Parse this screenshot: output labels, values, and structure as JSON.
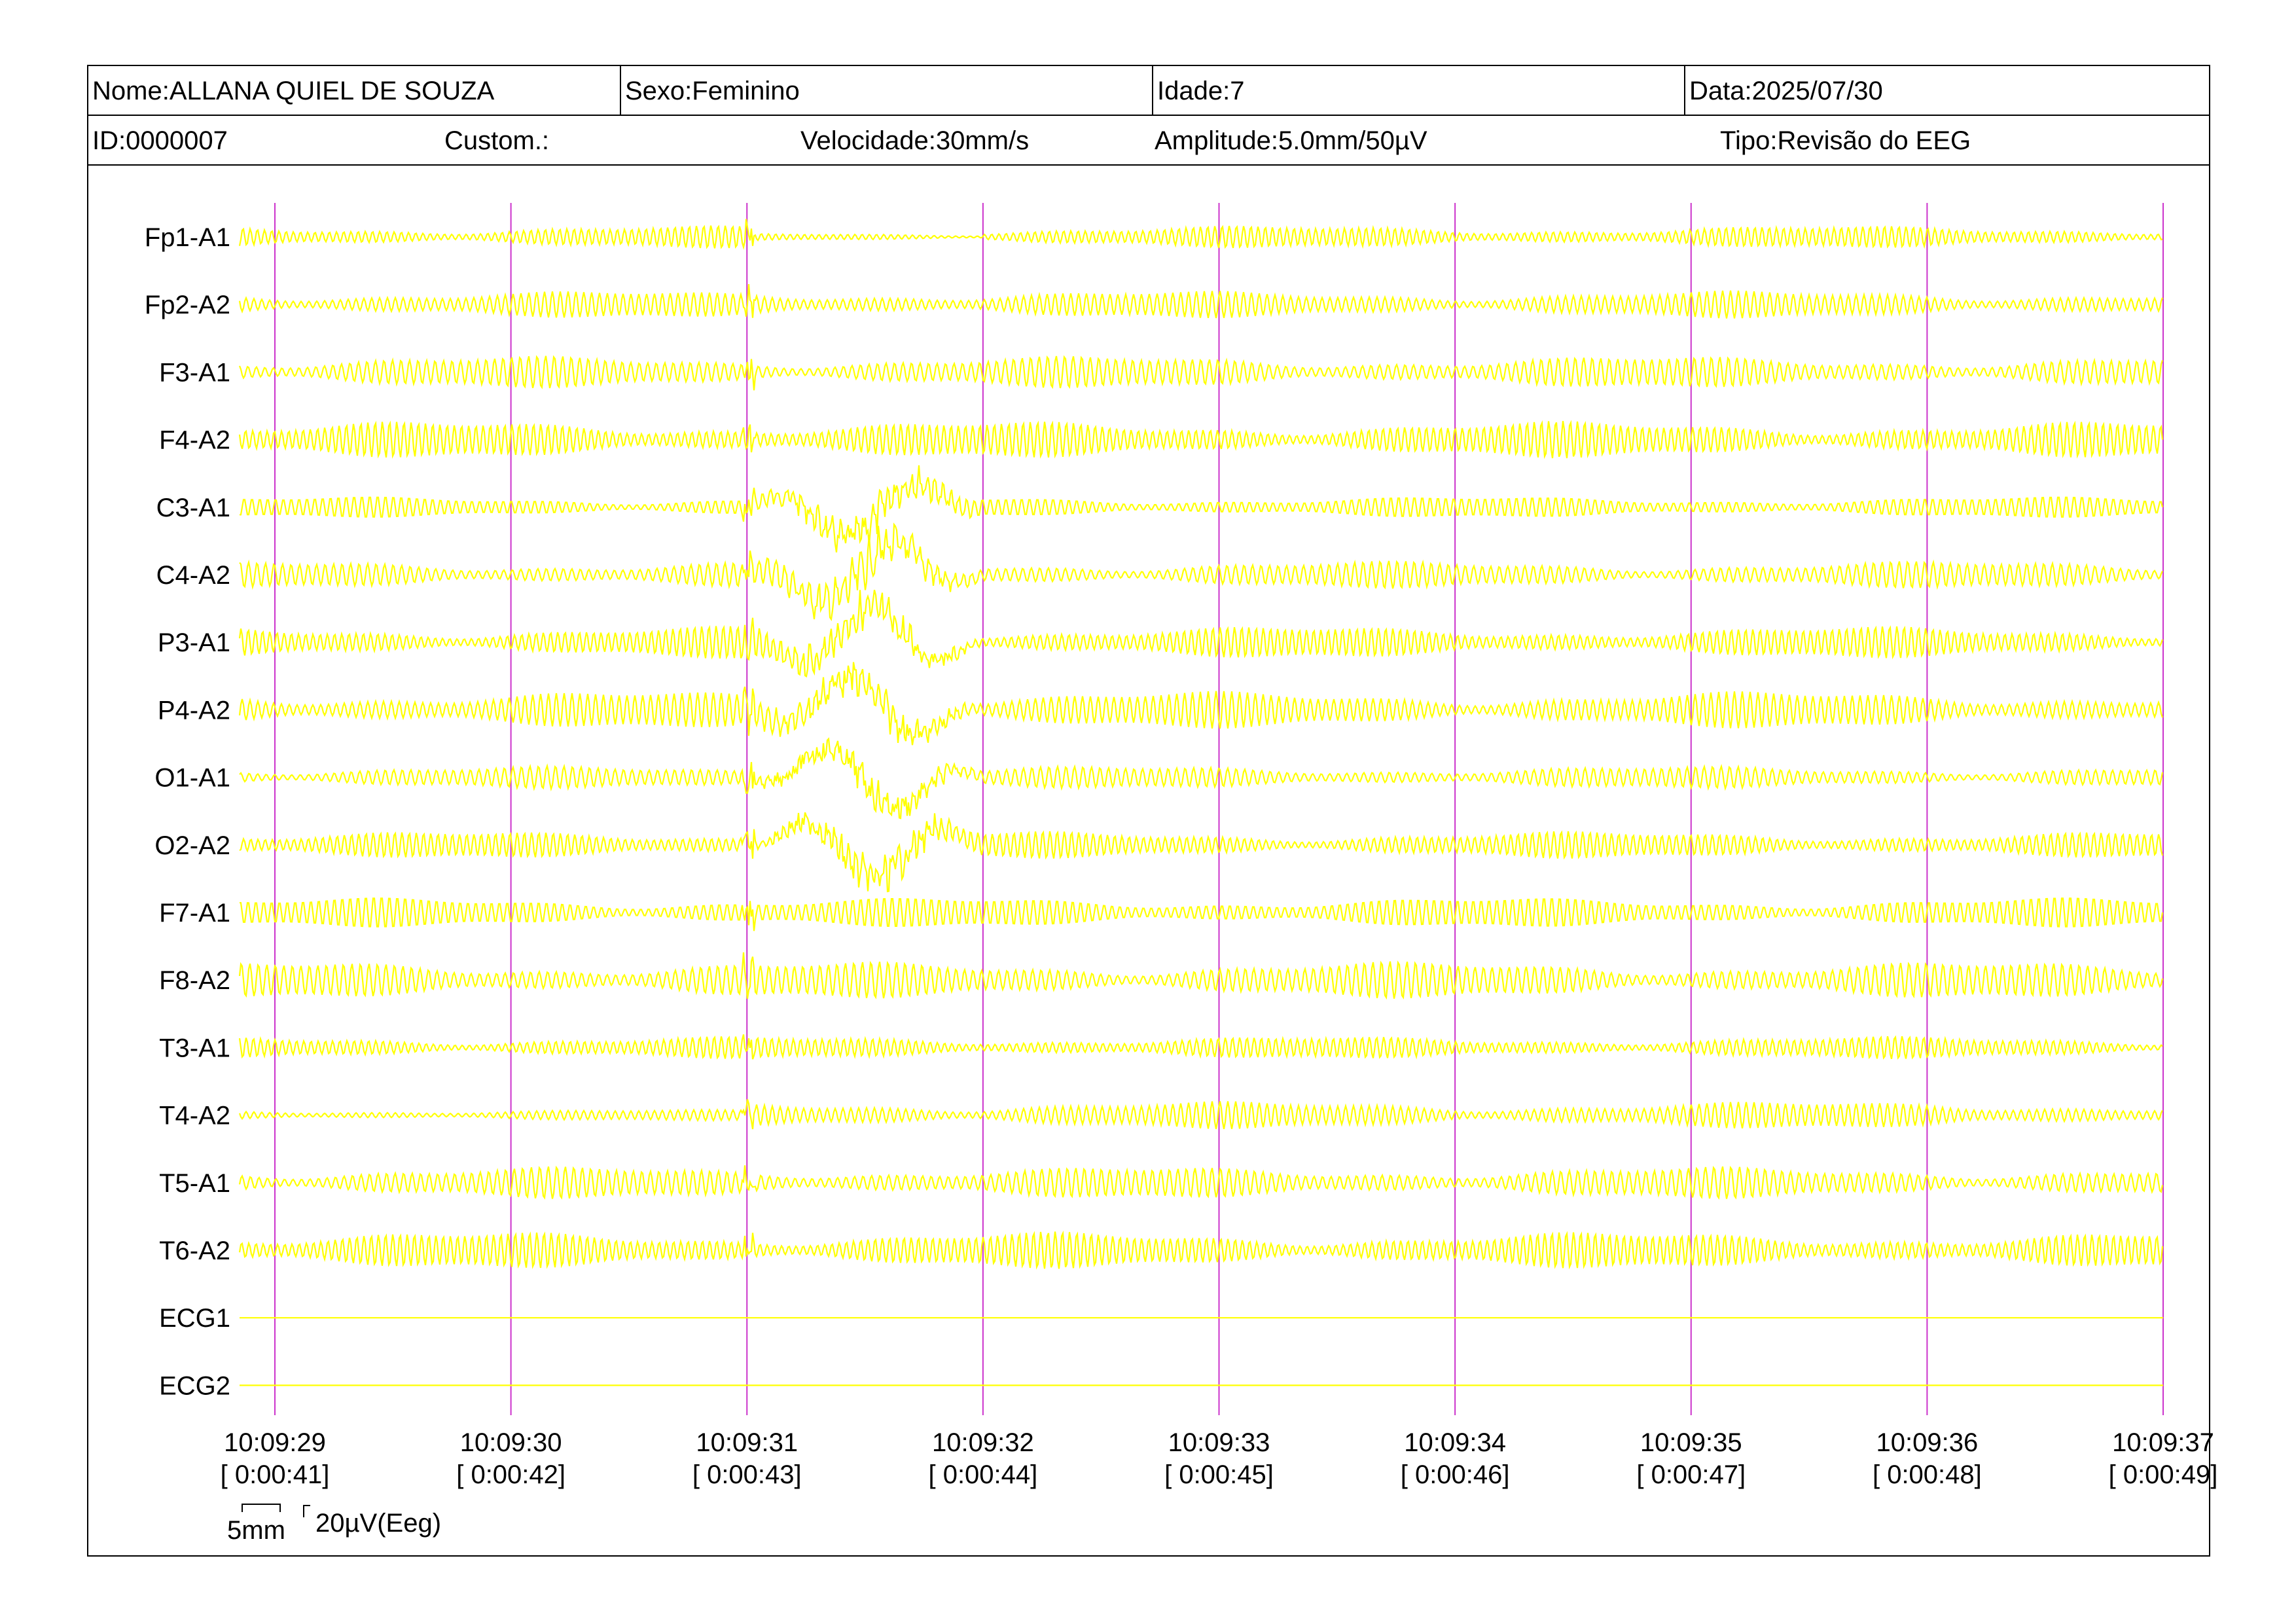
{
  "header": {
    "name_label": "Nome:ALLANA QUIEL DE SOUZA",
    "sex_label": "Sexo:Feminino",
    "age_label": "Idade:7",
    "date_label": "Data:2025/07/30",
    "id_label": "ID:0000007",
    "custom_label": "Custom.:",
    "speed_label": "Velocidade:30mm/s",
    "amplitude_label": "Amplitude:5.0mm/50µV",
    "type_label": "Tipo:Revisão do EEG"
  },
  "channels": [
    "Fp1-A1",
    "Fp2-A2",
    "F3-A1",
    "F4-A2",
    "C3-A1",
    "C4-A2",
    "P3-A1",
    "P4-A2",
    "O1-A1",
    "O2-A2",
    "F7-A1",
    "F8-A2",
    "T3-A1",
    "T4-A2",
    "T5-A1",
    "T6-A2",
    "ECG1",
    "ECG2"
  ],
  "time_marks": [
    {
      "clock": "10:09:29",
      "elapsed": "[ 0:00:41]"
    },
    {
      "clock": "10:09:30",
      "elapsed": "[ 0:00:42]"
    },
    {
      "clock": "10:09:31",
      "elapsed": "[ 0:00:43]"
    },
    {
      "clock": "10:09:32",
      "elapsed": "[ 0:00:44]"
    },
    {
      "clock": "10:09:33",
      "elapsed": "[ 0:00:45]"
    },
    {
      "clock": "10:09:34",
      "elapsed": "[ 0:00:46]"
    },
    {
      "clock": "10:09:35",
      "elapsed": "[ 0:00:47]"
    },
    {
      "clock": "10:09:36",
      "elapsed": "[ 0:00:48]"
    },
    {
      "clock": "10:09:37",
      "elapsed": "[ 0:00:49]"
    }
  ],
  "scale": {
    "time_label": "5mm",
    "amp_label": "20µV(Eeg)"
  },
  "colors": {
    "trace": "#ffff00",
    "second_marker": "#cc33cc",
    "frame": "#000000"
  }
}
